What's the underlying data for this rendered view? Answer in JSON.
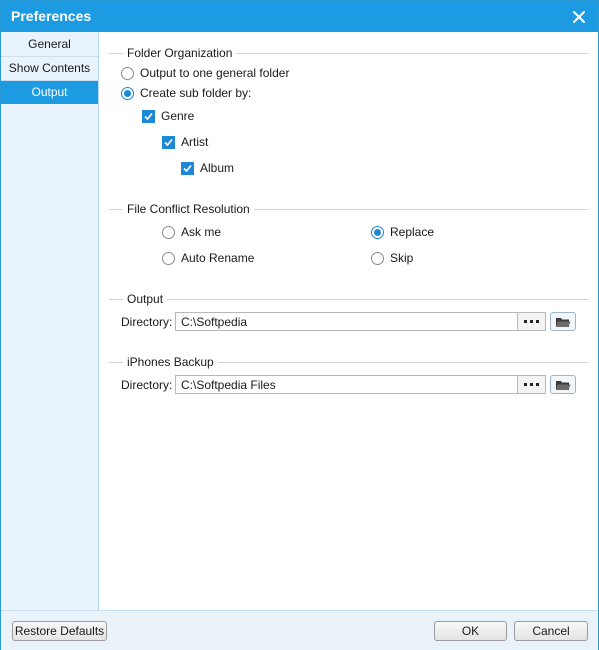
{
  "window": {
    "title": "Preferences"
  },
  "sidebar": {
    "items": [
      {
        "label": "General"
      },
      {
        "label": "Show Contents"
      },
      {
        "label": "Output"
      }
    ]
  },
  "folder_organization": {
    "title": "Folder Organization",
    "option_general": "Output to one general folder",
    "option_sub": "Create sub folder by:",
    "selected": "Create sub folder by:",
    "genre": {
      "label": "Genre",
      "checked": true
    },
    "artist": {
      "label": "Artist",
      "checked": true
    },
    "album": {
      "label": "Album",
      "checked": true
    }
  },
  "conflict": {
    "title": "File Conflict Resolution",
    "ask_me": "Ask me",
    "auto_rename": "Auto Rename",
    "replace": "Replace",
    "skip": "Skip",
    "selected": "Replace"
  },
  "output": {
    "title": "Output",
    "dir_label": "Directory:",
    "dir_value": "C:\\Softpedia"
  },
  "backup": {
    "title": "iPhones Backup",
    "dir_label": "Directory:",
    "dir_value": "C:\\Softpedia Files"
  },
  "footer": {
    "restore_label": "Restore Defaults",
    "ok_label": "OK",
    "cancel_label": "Cancel"
  },
  "icons": {
    "close": "close-icon",
    "more": "ellipsis-icon",
    "folder": "folder-icon",
    "check": "checkmark-icon"
  },
  "colors": {
    "accent": "#1d9be2",
    "sidebar_bg": "#e8f3fb"
  }
}
